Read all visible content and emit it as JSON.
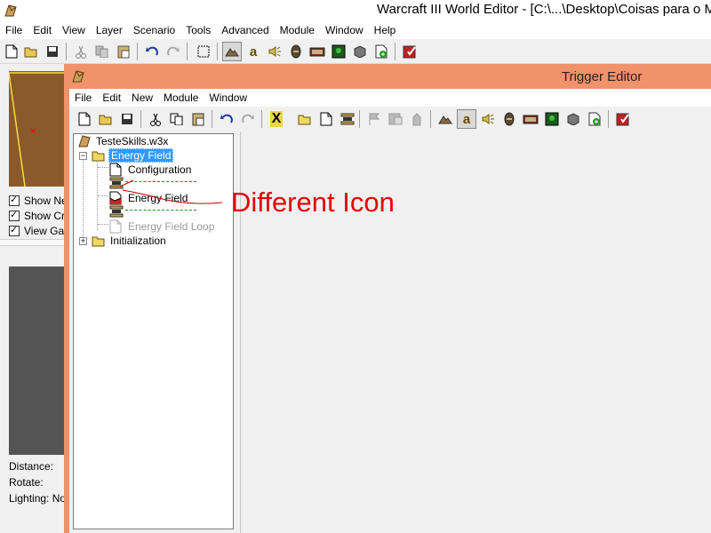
{
  "main_window": {
    "title": "Warcraft III World Editor - [C:\\...\\Desktop\\Coisas para o M",
    "menu": [
      "File",
      "Edit",
      "View",
      "Layer",
      "Scenario",
      "Tools",
      "Advanced",
      "Module",
      "Window",
      "Help"
    ],
    "toolbar_icons": [
      "new-icon",
      "open-icon",
      "save-icon",
      "cut-icon",
      "copy-icon",
      "paste-icon",
      "undo-icon",
      "redo-icon",
      "select-icon",
      "terrain-palette-icon",
      "unit-palette-icon",
      "sound-icon",
      "object-editor-icon",
      "campaign-icon",
      "ai-editor-icon",
      "import-icon",
      "test-map-icon",
      "exit-icon"
    ],
    "left_pane": {
      "checkboxes": [
        {
          "label": "Show Ne",
          "checked": true
        },
        {
          "label": "Show Cr",
          "checked": true
        },
        {
          "label": "View Gam",
          "checked": true
        }
      ],
      "stats": [
        "Distance:",
        "Rotate:",
        "Lighting: Noo"
      ]
    }
  },
  "trigger_editor": {
    "title": "Trigger Editor",
    "menu": [
      "File",
      "Edit",
      "New",
      "Module",
      "Window"
    ],
    "tree": {
      "root": "TesteSkills.w3x",
      "category": "Energy Field",
      "items": [
        {
          "label": "Configuration",
          "state": "normal"
        },
        {
          "label": "Energy Field",
          "state": "normal"
        },
        {
          "label": "Energy Field Loop",
          "state": "disabled"
        }
      ],
      "second_category": "Initialization"
    }
  },
  "annotation": {
    "text": "Different Icon",
    "color": "#e60000"
  },
  "colors": {
    "te_titlebar": "#f0926a",
    "selection": "#3399ff",
    "minimap": "#8b5a2b"
  }
}
